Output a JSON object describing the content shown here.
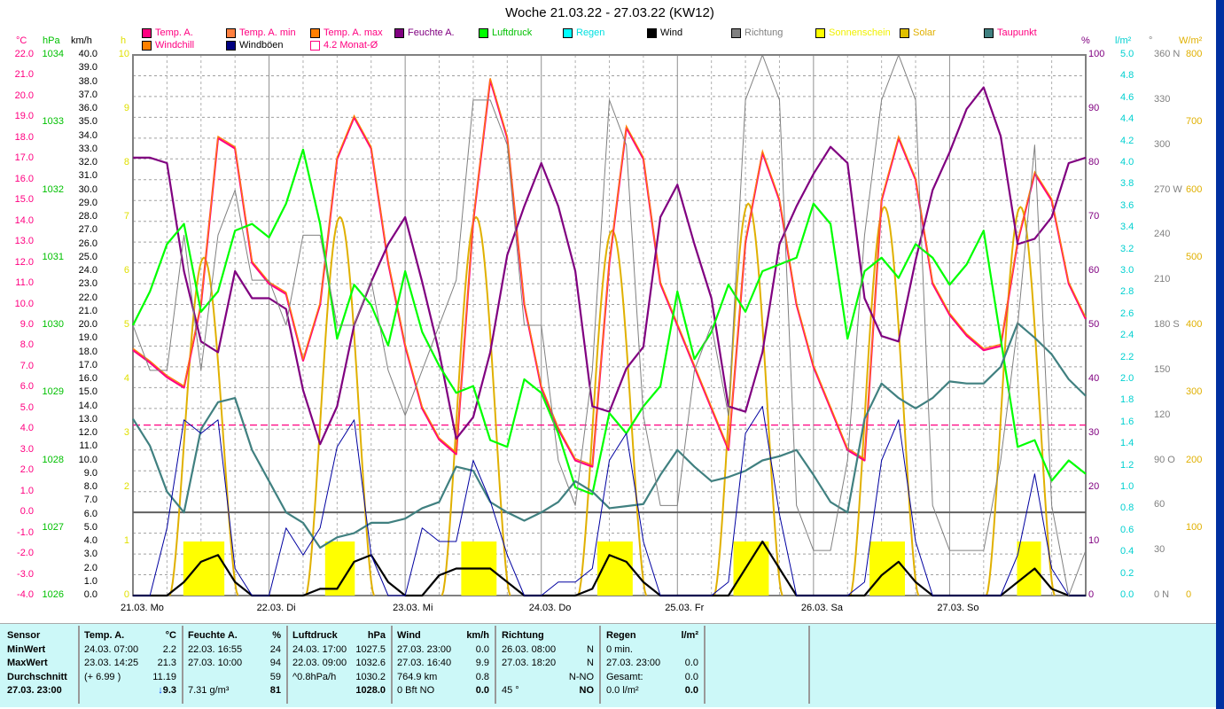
{
  "title": "Woche 21.03.22 - 27.03.22 (KW12)",
  "legend": [
    {
      "label": "Temp. A.",
      "color": "#ff0080",
      "text_color": "#ff0080"
    },
    {
      "label": "Temp. A. min",
      "color": "#ff8040",
      "text_color": "#ff0080"
    },
    {
      "label": "Temp. A. max",
      "color": "#ff8000",
      "text_color": "#ff0080"
    },
    {
      "label": "Feuchte A.",
      "color": "#800080",
      "text_color": "#800080"
    },
    {
      "label": "Luftdruck",
      "color": "#00ff00",
      "text_color": "#00c000"
    },
    {
      "label": "Regen",
      "color": "#00ffff",
      "text_color": "#00e0e0"
    },
    {
      "label": "Wind",
      "color": "#000000",
      "text_color": "#000000"
    },
    {
      "label": "Richtung",
      "color": "#808080",
      "text_color": "#808080"
    },
    {
      "label": "Sonnenschein",
      "color": "#ffff00",
      "text_color": "#f0f000"
    },
    {
      "label": "Solar",
      "color": "#e0c000",
      "text_color": "#e0b000"
    },
    {
      "label": "Taupunkt",
      "color": "#408080",
      "text_color": "#ff0080"
    },
    {
      "label": "Windchill",
      "color": "#ff8000",
      "text_color": "#ff0080"
    },
    {
      "label": "Windböen",
      "color": "#000080",
      "text_color": "#000000"
    },
    {
      "label": "4.2 Monat-Ø",
      "color": "#ffffff",
      "text_color": "#ff0080"
    }
  ],
  "axes": {
    "temp": {
      "unit": "°C",
      "min": -4,
      "max": 22,
      "step": 1,
      "color": "#ff0080"
    },
    "pressure": {
      "unit": "hPa",
      "min": 1026,
      "max": 1034,
      "step": 1,
      "color": "#00c000"
    },
    "wind": {
      "unit": "km/h",
      "min": 0,
      "max": 40,
      "step": 1,
      "color": "#000000"
    },
    "sun": {
      "unit": "h",
      "min": 0,
      "max": 10,
      "step": 1,
      "color": "#e0e000"
    },
    "humidity": {
      "unit": "%",
      "min": 0,
      "max": 100,
      "step": 10,
      "color": "#800080"
    },
    "rain": {
      "unit": "l/m²",
      "min": 0,
      "max": 5,
      "step": 0.2,
      "color": "#00d0d0"
    },
    "direction": {
      "unit": "°",
      "min": 0,
      "max": 360,
      "step": 30,
      "color": "#808080",
      "labels": {
        "0": "0 N",
        "90": "90 O",
        "180": "180 S",
        "270": "270 W",
        "360": "360 N"
      }
    },
    "solar": {
      "unit": "W/m²",
      "min": 0,
      "max": 800,
      "step": 100,
      "color": "#e0b000"
    }
  },
  "x_labels": [
    "21.03. Mo",
    "22.03. Di",
    "23.03. Mi",
    "24.03. Do",
    "25.03. Fr",
    "26.03. Sa",
    "27.03. So"
  ],
  "chart_data": {
    "type": "line",
    "x_unit": "hours since 21.03. 00:00",
    "x_range": [
      0,
      168
    ],
    "month_avg_temp": 4.2,
    "series": [
      {
        "name": "Temp. A.",
        "axis": "temp",
        "color": "#ff0080",
        "step": 3,
        "values": [
          7.8,
          7.2,
          6.5,
          6.0,
          10,
          18.0,
          17.5,
          12,
          11,
          10.5,
          7.3,
          10,
          17,
          19,
          17.5,
          12,
          8,
          5,
          3.5,
          2.8,
          14,
          20.8,
          18,
          10,
          6,
          4,
          2.5,
          2.2,
          12,
          18.5,
          17,
          11,
          9,
          7,
          5,
          3,
          13,
          17.3,
          15,
          10,
          7,
          5,
          3,
          2.5,
          15,
          18,
          16,
          11,
          9.5,
          8.5,
          7.8,
          8,
          13,
          16.3,
          15,
          11,
          9.3
        ]
      },
      {
        "name": "Feuchte A.",
        "axis": "humidity",
        "color": "#800080",
        "step": 3,
        "values": [
          81,
          81,
          80,
          60,
          47,
          45,
          60,
          55,
          55,
          53,
          38,
          28,
          35,
          50,
          58,
          65,
          70,
          58,
          45,
          29,
          33,
          45,
          63,
          72,
          80,
          72,
          60,
          35,
          34,
          42,
          46,
          70,
          76,
          65,
          55,
          35,
          34,
          45,
          65,
          72,
          78,
          83,
          80,
          55,
          48,
          47,
          62,
          75,
          82,
          90,
          94,
          85,
          65,
          66,
          70,
          80,
          81
        ]
      },
      {
        "name": "Luftdruck",
        "axis": "pressure",
        "color": "#00ff00",
        "step": 3,
        "values": [
          1030,
          1030.5,
          1031.2,
          1031.5,
          1030.2,
          1030.5,
          1031.4,
          1031.5,
          1031.3,
          1031.8,
          1032.6,
          1031.5,
          1029.8,
          1030.6,
          1030.3,
          1029.7,
          1030.8,
          1029.9,
          1029.4,
          1029.0,
          1029.1,
          1028.3,
          1028.2,
          1029.2,
          1029.0,
          1028.4,
          1027.6,
          1027.5,
          1028.7,
          1028.4,
          1028.8,
          1029.1,
          1030.5,
          1029.5,
          1029.9,
          1030.6,
          1030.2,
          1030.8,
          1030.9,
          1031.0,
          1031.8,
          1031.5,
          1029.8,
          1030.8,
          1031.0,
          1030.7,
          1031.2,
          1031.0,
          1030.6,
          1030.9,
          1031.4,
          1029.8,
          1028.2,
          1028.3,
          1027.7,
          1028.0,
          1027.8
        ]
      },
      {
        "name": "Taupunkt",
        "axis": "temp",
        "color": "#408080",
        "step": 3,
        "values": [
          4.5,
          3.2,
          1,
          0,
          4,
          5.3,
          5.5,
          3,
          1.5,
          0,
          -0.5,
          -1.7,
          -1.2,
          -1,
          -0.5,
          -0.5,
          -0.3,
          0.2,
          0.5,
          2.2,
          2,
          0.5,
          0,
          -0.4,
          0,
          0.5,
          1.5,
          1.0,
          0.2,
          0.3,
          0.4,
          1.8,
          3,
          2.2,
          1.5,
          1.7,
          2,
          2.5,
          2.7,
          3.0,
          1.8,
          0.5,
          0,
          4.5,
          6.2,
          5.5,
          5,
          5.5,
          6.3,
          6.2,
          6.2,
          7,
          9.1,
          8.4,
          7.6,
          6.4,
          5.6
        ]
      },
      {
        "name": "Wind",
        "axis": "wind",
        "color": "#000000",
        "step": 3,
        "values": [
          0,
          0,
          0,
          1,
          2.5,
          3,
          1,
          0,
          0,
          0,
          0,
          0.5,
          0.5,
          2.5,
          3,
          1,
          0,
          0,
          1.5,
          2,
          2,
          2,
          1,
          0,
          0,
          0,
          0,
          0.5,
          3,
          2.5,
          1,
          0,
          0,
          0,
          0,
          0,
          2,
          4,
          2,
          0,
          0,
          0,
          0,
          0,
          1.5,
          2.5,
          1,
          0,
          0,
          0,
          0,
          0,
          1,
          2,
          0.5,
          0,
          0
        ]
      },
      {
        "name": "Windböen",
        "axis": "wind",
        "color": "#0000a0",
        "step": 3,
        "values": [
          0,
          0,
          5,
          13,
          12,
          13,
          2,
          0,
          0,
          5,
          3,
          5,
          11,
          13,
          3,
          0,
          0,
          5,
          4,
          4,
          10,
          7,
          3,
          0,
          0,
          1,
          1,
          2,
          10,
          12,
          4,
          0,
          0,
          0,
          0,
          1,
          12,
          14,
          6,
          0,
          0,
          0,
          0,
          1,
          10,
          13,
          4,
          0,
          0,
          0,
          0,
          0,
          3,
          9,
          2,
          0,
          0
        ]
      },
      {
        "name": "Richtung",
        "axis": "direction",
        "color": "#808080",
        "step": 3,
        "values": [
          180,
          150,
          150,
          240,
          150,
          240,
          270,
          210,
          210,
          180,
          240,
          240,
          180,
          180,
          210,
          150,
          120,
          150,
          180,
          210,
          330,
          330,
          300,
          180,
          180,
          90,
          60,
          150,
          330,
          300,
          120,
          60,
          60,
          150,
          180,
          120,
          330,
          360,
          330,
          60,
          30,
          30,
          90,
          240,
          330,
          360,
          330,
          60,
          30,
          30,
          30,
          90,
          180,
          300,
          60,
          0,
          30
        ]
      }
    ],
    "solar_daily_peak_wm2": [
      500,
      560,
      560,
      540,
      580,
      575,
      575
    ],
    "sunshine_daily_hours_per_interval": [
      1,
      1,
      1,
      1,
      1,
      1,
      1
    ],
    "sunshine_windows_hours": [
      [
        9,
        16
      ],
      [
        10,
        15
      ],
      [
        10,
        16
      ],
      [
        10,
        16
      ],
      [
        10,
        16
      ],
      [
        10,
        16
      ],
      [
        12,
        16
      ]
    ],
    "rain_total": 0.0
  },
  "table": {
    "sensor": {
      "header": "Sensor",
      "rows": [
        "MinWert",
        "MaxWert",
        "Durchschnitt",
        "27.03. 23:00"
      ]
    },
    "temp": {
      "header": "Temp. A.",
      "unit": "°C",
      "min_time": "24.03.  07:00",
      "min": "2.2",
      "max_time": "23.03.  14:25",
      "max": "21.3",
      "avg_note": "(+ 6.99 )",
      "avg": "11.19",
      "current": "9.3",
      "trend": "↓"
    },
    "humidity": {
      "header": "Feuchte A.",
      "unit": "%",
      "min_time": "22.03.  16:55",
      "min": "24",
      "max_time": "27.03.  10:00",
      "max": "94",
      "avg": "59",
      "abs": "7.31 g/m³",
      "current": "81"
    },
    "pressure": {
      "header": "Luftdruck",
      "unit": "hPa",
      "min_time": "24.03.  17:00",
      "min": "1027.5",
      "max_time": "22.03.  09:00",
      "max": "1032.6",
      "trend": "^0.8hPa/h",
      "avg": "1030.2",
      "current": "1028.0"
    },
    "wind": {
      "header": "Wind",
      "unit": "km/h",
      "min_time": "27.03.  23:00",
      "min": "0.0",
      "max_time": "27.03.  16:40",
      "max": "9.9",
      "run": "764.9 km",
      "avg": "0.8",
      "bft": "0 Bft NO",
      "current": "0.0"
    },
    "direction": {
      "header": "Richtung",
      "min_time": "26.03.  08:00",
      "min": "N",
      "max_time": "27.03.  18:20",
      "max": "N",
      "avg": "N-NO",
      "deg": "45 °",
      "current": "NO"
    },
    "rain": {
      "header": "Regen",
      "unit": "l/m²",
      "duration": "0 min.",
      "max_time": "27.03.  23:00",
      "max": "0.0",
      "total_label": "Gesamt:",
      "total": "0.0",
      "current_amount": "0.0 l/m²",
      "current": "0.0"
    }
  }
}
